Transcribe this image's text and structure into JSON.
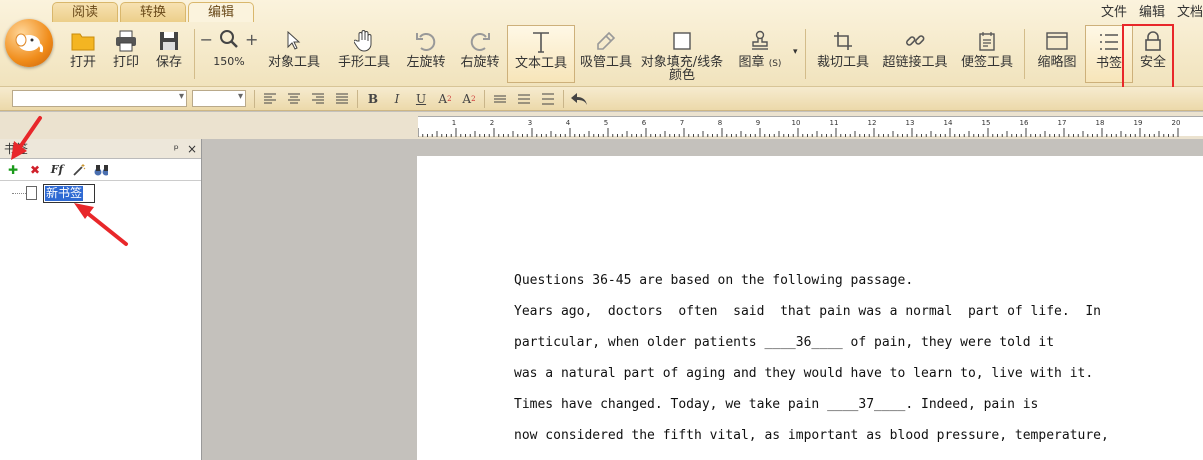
{
  "tabs": [
    "阅读",
    "转换",
    "编辑"
  ],
  "active_tab": "编辑",
  "top_menu": [
    "文件",
    "编辑",
    "文档"
  ],
  "toolbar": {
    "open": "打开",
    "print": "打印",
    "save": "保存",
    "zoom": "150%",
    "object_tool": "对象工具",
    "hand_tool": "手形工具",
    "rotate_left": "左旋转",
    "rotate_right": "右旋转",
    "text_tool": "文本工具",
    "eyedropper": "吸管工具",
    "fill_line_1": "对象填充/线条",
    "fill_line_2": "颜色",
    "stamp": "图章",
    "stamp_key": "(S)",
    "crop": "裁切工具",
    "hyperlink": "超链接工具",
    "note": "便签工具",
    "thumbnail": "缩略图",
    "bookmark": "书签",
    "security": "安全"
  },
  "panel": {
    "title": "书签",
    "pin": "ᵖ",
    "close": "×",
    "new_bookmark_text": "新书签"
  },
  "ruler_labels": [
    "1",
    "2",
    "3",
    "4",
    "5",
    "6",
    "7",
    "8",
    "9",
    "10",
    "11",
    "12",
    "13",
    "14",
    "15",
    "16",
    "17",
    "18",
    "19",
    "20"
  ],
  "document": {
    "lines": [
      "Questions 36-45 are based on the following passage.",
      "Years ago,  doctors  often  said  that pain was a normal  part of life.  In",
      "particular, when older patients ____36____ of pain, they were told it",
      "was a natural part of aging and they would have to learn to, live with it.",
      "Times have changed. Today, we take pain ____37____. Indeed, pain is",
      "now considered the fifth vital, as important as blood pressure, temperature,"
    ]
  },
  "colors": {
    "accent_red": "#e8272a",
    "selection_blue": "#2f6ad3"
  }
}
